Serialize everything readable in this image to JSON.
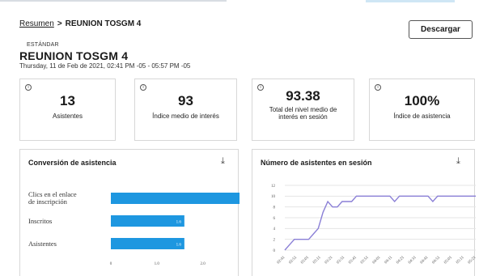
{
  "breadcrumb": {
    "root": "Resumen",
    "separator": ">",
    "current": "REUNION TOSGM 4"
  },
  "actions": {
    "download_label": "Descargar"
  },
  "event": {
    "tier": "ESTÁNDAR",
    "title": "REUNION TOSGM 4",
    "subtitle": "Thursday, 11 de Feb de 2021, 02:41 PM -05 - 05:57 PM -05"
  },
  "stats": [
    {
      "value": "13",
      "label": "Asistentes"
    },
    {
      "value": "93",
      "label": "Índice medio de interés"
    },
    {
      "value": "93.38",
      "label": "Total del nivel medio de interés en sesión"
    },
    {
      "value": "100%",
      "label": "Índice de asistencia"
    }
  ],
  "icons": {
    "info": "info-icon",
    "download": "download-icon"
  },
  "colors": {
    "bar": "#1e97e0",
    "line": "#8a7fd6",
    "grid": "#e5e5e5"
  },
  "conversion_panel": {
    "title": "Conversión de asistencia",
    "download_glyph": "⤓"
  },
  "attendance_panel": {
    "title": "Número de asistentes en sesión",
    "download_glyph": "⤓"
  },
  "chart_data": [
    {
      "type": "bar",
      "orientation": "horizontal",
      "categories": [
        "Clics en el enlace de inscripción",
        "Inscritos",
        "Asistentes"
      ],
      "values": [
        2.8,
        1.6,
        1.6
      ],
      "data_labels": [
        "",
        "1.6",
        "1.6"
      ],
      "x_ticks": [
        "0",
        "1.0",
        "2.0"
      ],
      "xlim": [
        0,
        2.8
      ],
      "grid": false
    },
    {
      "type": "line",
      "x": [
        "02:41",
        "02:51",
        "03:01",
        "03:11",
        "03:21",
        "03:31",
        "03:41",
        "03:51",
        "04:01",
        "04:11",
        "04:21",
        "04:31",
        "04:41",
        "04:51",
        "05:01",
        "05:11",
        "05:21"
      ],
      "series": [
        {
          "values": [
            0,
            2,
            2,
            5,
            9,
            7.5,
            9,
            9,
            10,
            10,
            10,
            10,
            10,
            9,
            10,
            10,
            10
          ]
        }
      ],
      "x_dense": [
        0,
        0.5,
        1,
        1.5,
        2,
        2.5,
        3,
        3.5,
        4,
        4.5,
        5,
        5.5,
        6,
        6.5,
        7,
        7.5,
        8,
        8.5,
        9,
        9.5,
        10,
        10.5,
        11,
        11.5,
        12,
        12.5,
        13,
        13.5,
        14,
        14.5,
        15,
        15.5,
        16,
        16.5,
        17,
        17.5,
        18,
        18.5,
        19,
        19.5,
        20
      ],
      "y_dense": [
        0,
        1,
        2,
        2,
        2,
        2,
        3,
        4,
        7,
        9,
        8,
        8,
        9,
        9,
        9,
        10,
        10,
        10,
        10,
        10,
        10,
        10,
        10,
        9,
        10,
        10,
        10,
        10,
        10,
        10,
        10,
        9,
        10,
        10,
        10,
        10,
        10,
        10,
        10,
        10,
        10
      ],
      "y_ticks": [
        "0",
        "2",
        "4",
        "6",
        "8",
        "10",
        "12"
      ],
      "ylim": [
        0,
        12
      ],
      "grid": true
    }
  ]
}
